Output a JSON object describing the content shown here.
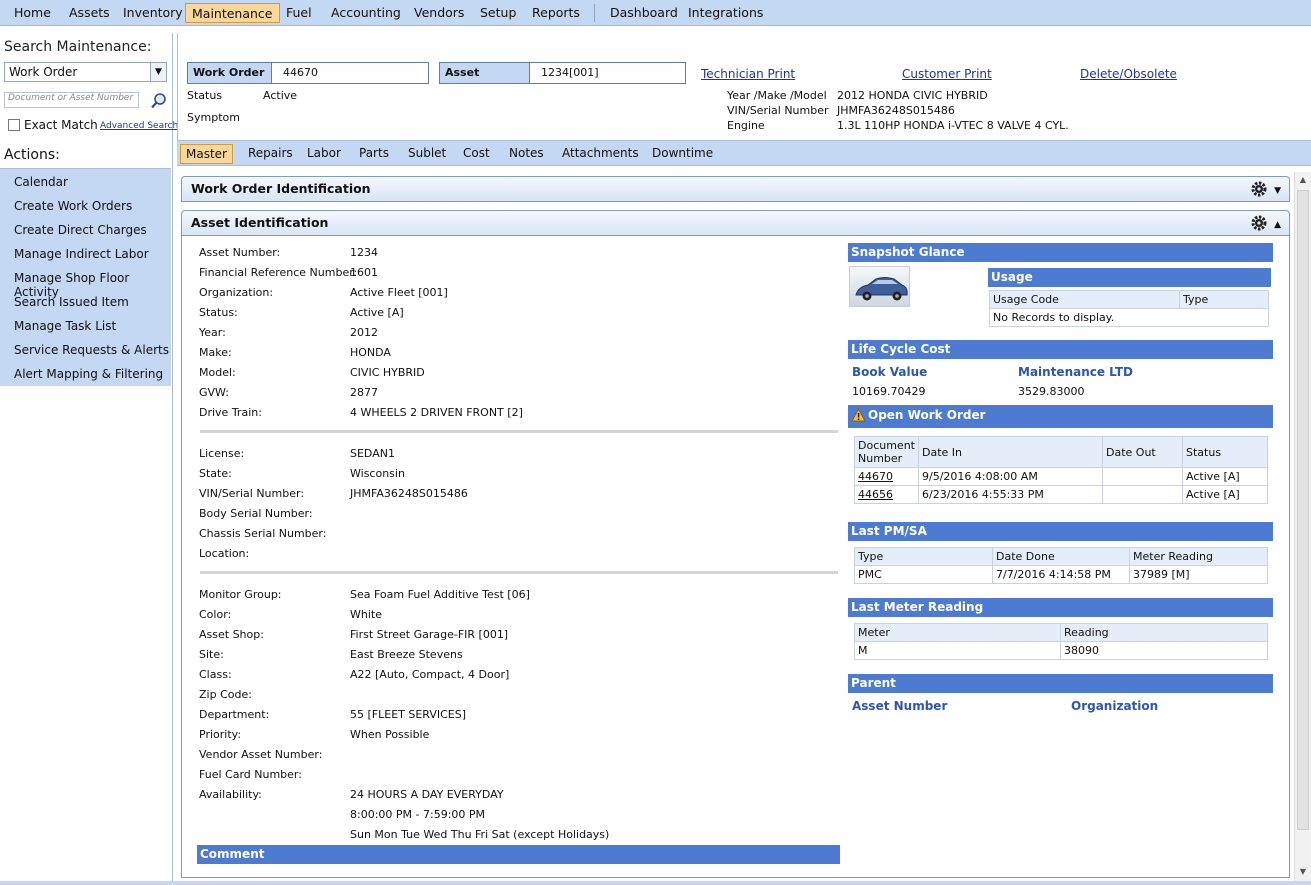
{
  "nav": {
    "items": [
      "Home",
      "Assets",
      "Inventory",
      "Maintenance",
      "Fuel",
      "Accounting",
      "Vendors",
      "Setup",
      "Reports",
      "Dashboard",
      "Integrations"
    ],
    "active": "Maintenance"
  },
  "sidebar": {
    "search_title": "Search Maintenance:",
    "search_type": "Work Order",
    "search_placeholder": "Document or Asset Number",
    "exact_match": "Exact Match",
    "advanced_search": "Advanced Search",
    "actions_title": "Actions:",
    "actions": [
      "Calendar",
      "Create Work Orders",
      "Create Direct Charges",
      "Manage Indirect Labor",
      "Manage Shop Floor Activity",
      "Search Issued Item",
      "Manage Task List",
      "Service Requests & Alerts",
      "Alert Mapping & Filtering"
    ]
  },
  "header": {
    "work_order_label": "Work Order",
    "work_order_value": "44670",
    "asset_label": "Asset",
    "asset_value": "1234[001]",
    "technician_print": "Technician Print",
    "customer_print": "Customer Print",
    "delete_obsolete": "Delete/Obsolete",
    "status_label": "Status",
    "status_value": "Active",
    "symptom_label": "Symptom",
    "ymm_label": "Year /Make /Model",
    "ymm_value": "2012 HONDA CIVIC HYBRID",
    "vin_label": "VIN/Serial Number",
    "vin_value": "JHMFA36248S015486",
    "engine_label": "Engine",
    "engine_value": "1.3L 110HP HONDA i-VTEC 8 VALVE 4 CYL."
  },
  "tabs": [
    "Master",
    "Repairs",
    "Labor",
    "Parts",
    "Sublet",
    "Cost",
    "Notes",
    "Attachments",
    "Downtime"
  ],
  "sections": {
    "wo_ident": "Work Order Identification",
    "asset_ident": "Asset Identification"
  },
  "asset": {
    "group1": [
      [
        "Asset Number:",
        "1234"
      ],
      [
        "Financial Reference Number:",
        "1601"
      ],
      [
        "Organization:",
        "Active Fleet [001]"
      ],
      [
        "Status:",
        "Active [A]"
      ],
      [
        "Year:",
        "2012"
      ],
      [
        "Make:",
        "HONDA"
      ],
      [
        "Model:",
        "CIVIC HYBRID"
      ],
      [
        "GVW:",
        "2877"
      ],
      [
        "Drive Train:",
        "4 WHEELS 2 DRIVEN FRONT [2]"
      ]
    ],
    "group2": [
      [
        "License:",
        "SEDAN1"
      ],
      [
        "State:",
        "Wisconsin"
      ],
      [
        "VIN/Serial Number:",
        "JHMFA36248S015486"
      ],
      [
        "Body Serial Number:",
        ""
      ],
      [
        "Chassis Serial Number:",
        ""
      ],
      [
        "Location:",
        ""
      ]
    ],
    "group3": [
      [
        "Monitor Group:",
        "Sea Foam Fuel Additive Test [06]"
      ],
      [
        "Color:",
        "White"
      ],
      [
        "Asset Shop:",
        "First Street Garage-FIR [001]"
      ],
      [
        "Site:",
        "East Breeze Stevens"
      ],
      [
        "Class:",
        "A22 [Auto, Compact, 4 Door]"
      ],
      [
        "Zip Code:",
        ""
      ],
      [
        "Department:",
        "55 [FLEET SERVICES]"
      ],
      [
        "Priority:",
        "When Possible"
      ],
      [
        "Vendor Asset Number:",
        ""
      ],
      [
        "Fuel Card Number:",
        ""
      ],
      [
        "Availability:",
        "24 HOURS A DAY EVERYDAY"
      ],
      [
        "",
        "8:00:00 PM - 7:59:00 PM"
      ],
      [
        "",
        "Sun Mon Tue Wed Thu Fri Sat (except Holidays)"
      ]
    ],
    "comment": "Comment"
  },
  "right": {
    "snapshot": "Snapshot Glance",
    "usage": "Usage",
    "usage_cols": [
      "Usage Code",
      "Type"
    ],
    "usage_empty": "No Records to display.",
    "lcc": "Life Cycle Cost",
    "book_value_label": "Book Value",
    "book_value": "10169.70429",
    "maint_ltd_label": "Maintenance LTD",
    "maint_ltd": "3529.83000",
    "open_wo": "Open Work Order",
    "open_wo_cols": [
      "Document Number",
      "Date In",
      "Date Out",
      "Status"
    ],
    "open_wo_rows": [
      [
        "44670",
        "9/5/2016 4:08:00 AM",
        "",
        "Active [A]"
      ],
      [
        "44656",
        "6/23/2016 4:55:33 PM",
        "",
        "Active [A]"
      ]
    ],
    "last_pm": "Last PM/SA",
    "last_pm_cols": [
      "Type",
      "Date Done",
      "Meter Reading"
    ],
    "last_pm_rows": [
      [
        "PMC",
        "7/7/2016 4:14:58 PM",
        "37989 [M]"
      ]
    ],
    "last_meter": "Last Meter Reading",
    "last_meter_cols": [
      "Meter",
      "Reading"
    ],
    "last_meter_rows": [
      [
        "M",
        "38090"
      ]
    ],
    "parent": "Parent",
    "parent_asset": "Asset Number",
    "parent_org": "Organization"
  }
}
